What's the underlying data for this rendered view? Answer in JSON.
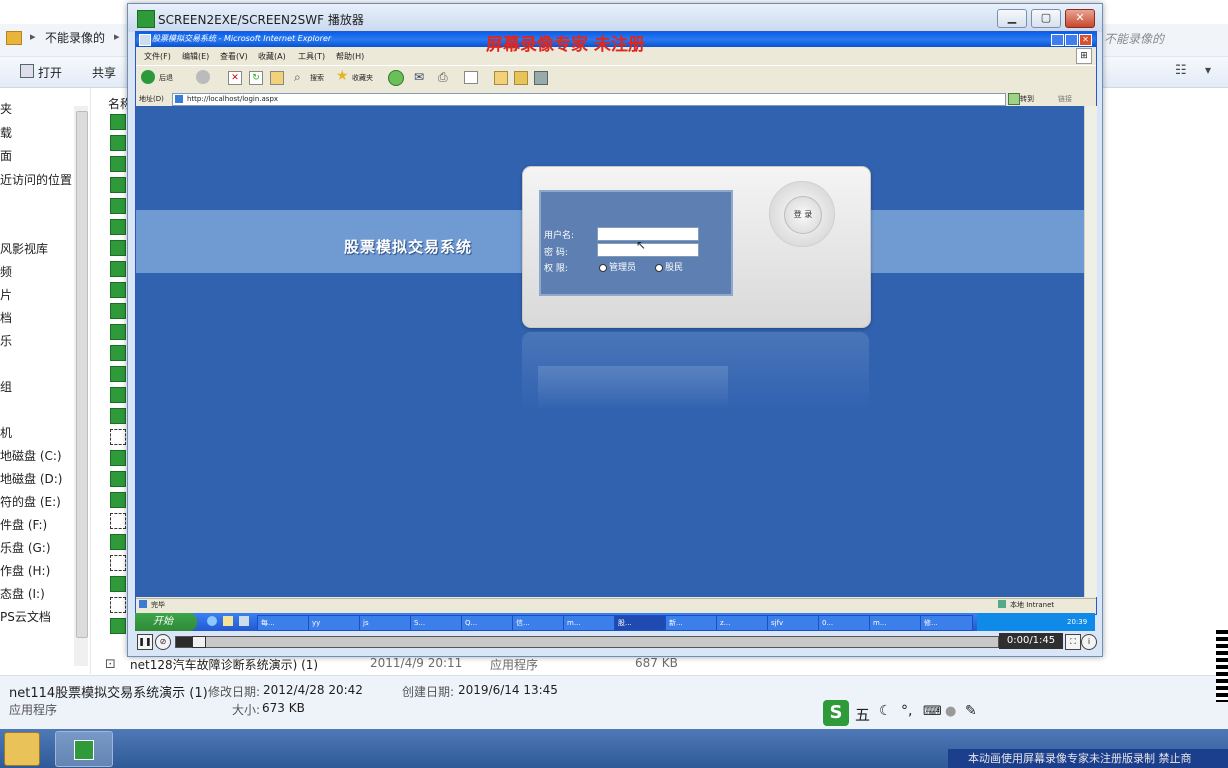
{
  "explorer": {
    "breadcrumb": [
      "不能录像的"
    ],
    "search_hint": "不能录像的",
    "toolbar": {
      "open": "打开",
      "share": "共享"
    },
    "column_name": "名称",
    "nav_items": [
      "夹",
      "载",
      "面",
      "近访问的位置",
      "风影视库",
      "频",
      "片",
      "档",
      "乐",
      "组",
      "机",
      "地磁盘 (C:)",
      "地磁盘 (D:)",
      "符的盘 (E:)",
      "件盘 (F:)",
      "乐盘 (G:)",
      "作盘 (H:)",
      "态盘 (I:)",
      "PS云文档"
    ],
    "bottom_file": {
      "name": "net128汽车故障诊断系统演示) (1)",
      "modified": "2011/4/9 20:11",
      "type": "应用程序",
      "size": "687 KB"
    },
    "details": {
      "name": "net114股票模拟交易系统演示 (1)",
      "modified_label": "修改日期:",
      "modified": "2012/4/28 20:42",
      "created_label": "创建日期:",
      "created": "2019/6/14 13:45",
      "type": "应用程序",
      "size_label": "大小:",
      "size": "673 KB"
    }
  },
  "player": {
    "title": "SCREEN2EXE/SCREEN2SWF 播放器",
    "watermark": "屏幕录像专家  未注册",
    "time": "0:00/1:45",
    "progress": 0.02,
    "bottom_watermark": "本动画使用屏幕录像专家未注册版录制 禁止商"
  },
  "ie": {
    "title": "股票模拟交易系统 - Microsoft Internet Explorer",
    "menu": [
      "文件(F)",
      "编辑(E)",
      "查看(V)",
      "收藏(A)",
      "工具(T)",
      "帮助(H)"
    ],
    "toolbar": {
      "back": "后退",
      "search": "搜索",
      "favorites": "收藏夹"
    },
    "address_label": "地址(D)",
    "url": "http://localhost/login.aspx",
    "go": "转到",
    "links": "链接",
    "status_left": "完毕",
    "status_right": "本地 Intranet"
  },
  "login": {
    "system_title": "股票模拟交易系统",
    "username_label": "用户名:",
    "password_label": "密    码:",
    "role_label": "权    限:",
    "role_admin": "管理员",
    "role_user": "股民",
    "login_button": "登 录"
  },
  "xp_taskbar": {
    "start": "开始",
    "tasks": [
      "每...",
      "yy",
      "js",
      "S...",
      "Q...",
      "信...",
      "m...",
      "股...",
      "新...",
      "z...",
      "sjfv",
      "0...",
      "m...",
      "修..."
    ],
    "clock": "20:39"
  },
  "ime": {
    "label": "五"
  }
}
